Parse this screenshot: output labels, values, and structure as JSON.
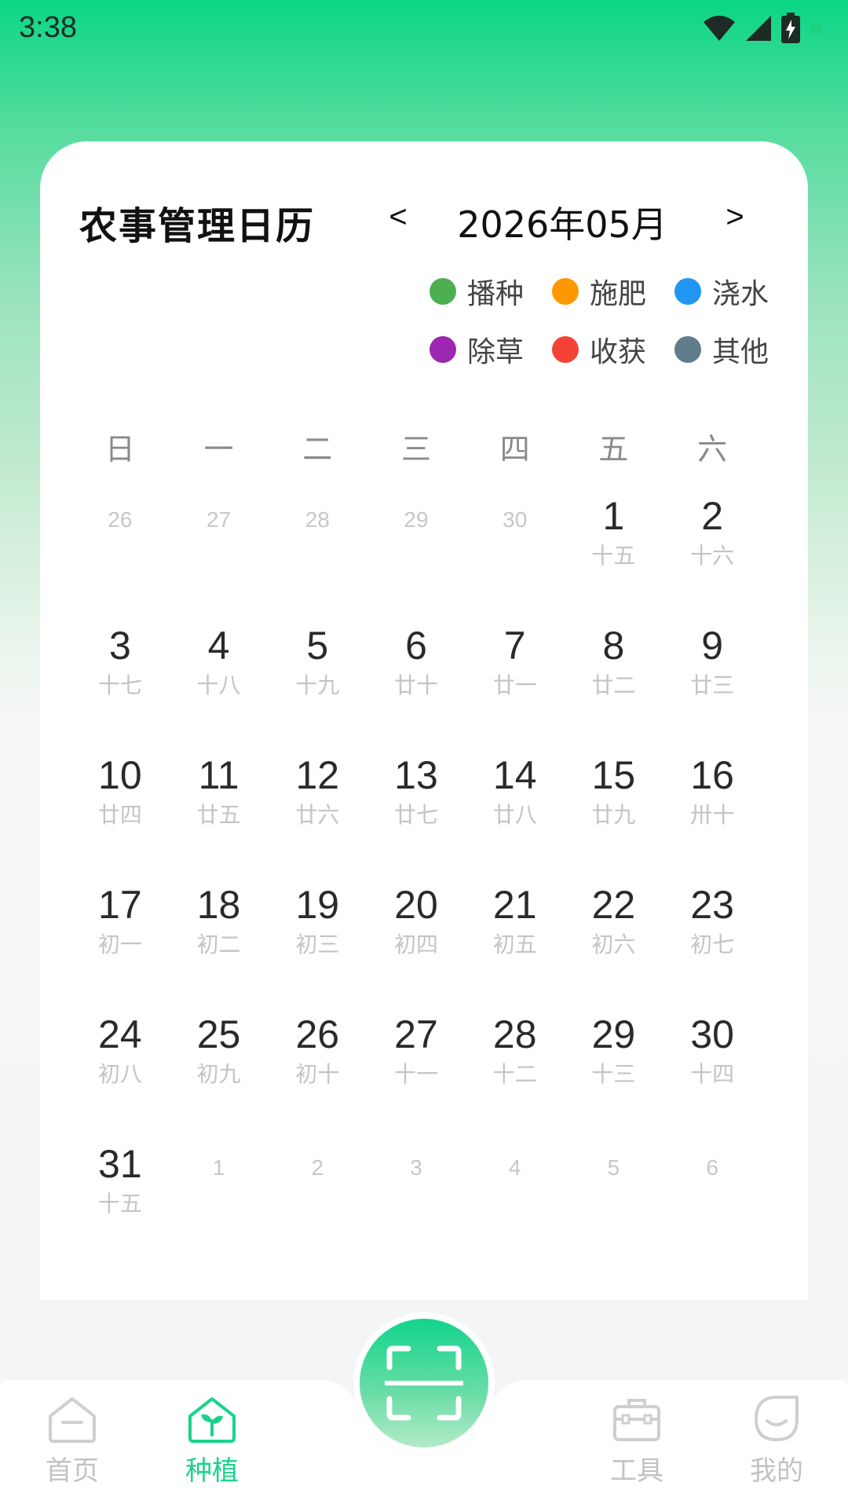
{
  "status": {
    "time": "3:38"
  },
  "calendar": {
    "title": "农事管理日历",
    "prev": "<",
    "next": ">",
    "month": "2026年05月",
    "legend": [
      {
        "label": "播种",
        "color": "#4CAF50"
      },
      {
        "label": "施肥",
        "color": "#FF9800"
      },
      {
        "label": "浇水",
        "color": "#2196F3"
      },
      {
        "label": "除草",
        "color": "#9C27B0"
      },
      {
        "label": "收获",
        "color": "#F44336"
      },
      {
        "label": "其他",
        "color": "#607D8B"
      }
    ],
    "weekdays": [
      "日",
      "一",
      "二",
      "三",
      "四",
      "五",
      "六"
    ],
    "days": [
      {
        "num": "26",
        "other": true
      },
      {
        "num": "27",
        "other": true
      },
      {
        "num": "28",
        "other": true
      },
      {
        "num": "29",
        "other": true
      },
      {
        "num": "30",
        "other": true
      },
      {
        "num": "1",
        "lunar": "十五"
      },
      {
        "num": "2",
        "lunar": "十六"
      },
      {
        "num": "3",
        "lunar": "十七"
      },
      {
        "num": "4",
        "lunar": "十八"
      },
      {
        "num": "5",
        "lunar": "十九"
      },
      {
        "num": "6",
        "lunar": "廿十"
      },
      {
        "num": "7",
        "lunar": "廿一"
      },
      {
        "num": "8",
        "lunar": "廿二"
      },
      {
        "num": "9",
        "lunar": "廿三"
      },
      {
        "num": "10",
        "lunar": "廿四"
      },
      {
        "num": "11",
        "lunar": "廿五"
      },
      {
        "num": "12",
        "lunar": "廿六"
      },
      {
        "num": "13",
        "lunar": "廿七"
      },
      {
        "num": "14",
        "lunar": "廿八"
      },
      {
        "num": "15",
        "lunar": "廿九"
      },
      {
        "num": "16",
        "lunar": "卅十"
      },
      {
        "num": "17",
        "lunar": "初一"
      },
      {
        "num": "18",
        "lunar": "初二"
      },
      {
        "num": "19",
        "lunar": "初三"
      },
      {
        "num": "20",
        "lunar": "初四"
      },
      {
        "num": "21",
        "lunar": "初五"
      },
      {
        "num": "22",
        "lunar": "初六"
      },
      {
        "num": "23",
        "lunar": "初七"
      },
      {
        "num": "24",
        "lunar": "初八"
      },
      {
        "num": "25",
        "lunar": "初九"
      },
      {
        "num": "26",
        "lunar": "初十"
      },
      {
        "num": "27",
        "lunar": "十一"
      },
      {
        "num": "28",
        "lunar": "十二"
      },
      {
        "num": "29",
        "lunar": "十三"
      },
      {
        "num": "30",
        "lunar": "十四"
      },
      {
        "num": "31",
        "lunar": "十五"
      },
      {
        "num": "1",
        "other": true
      },
      {
        "num": "2",
        "other": true
      },
      {
        "num": "3",
        "other": true
      },
      {
        "num": "4",
        "other": true
      },
      {
        "num": "5",
        "other": true
      },
      {
        "num": "6",
        "other": true
      }
    ]
  },
  "nav": {
    "home": "首页",
    "plant": "种植",
    "tools": "工具",
    "mine": "我的",
    "active_color": "#1AD38A",
    "inactive_color": "#C2C2C2"
  },
  "icons": {
    "home": "home-icon",
    "plant": "plant-house-icon",
    "scan": "scan-icon",
    "tools": "toolbox-icon",
    "mine": "smile-icon"
  }
}
